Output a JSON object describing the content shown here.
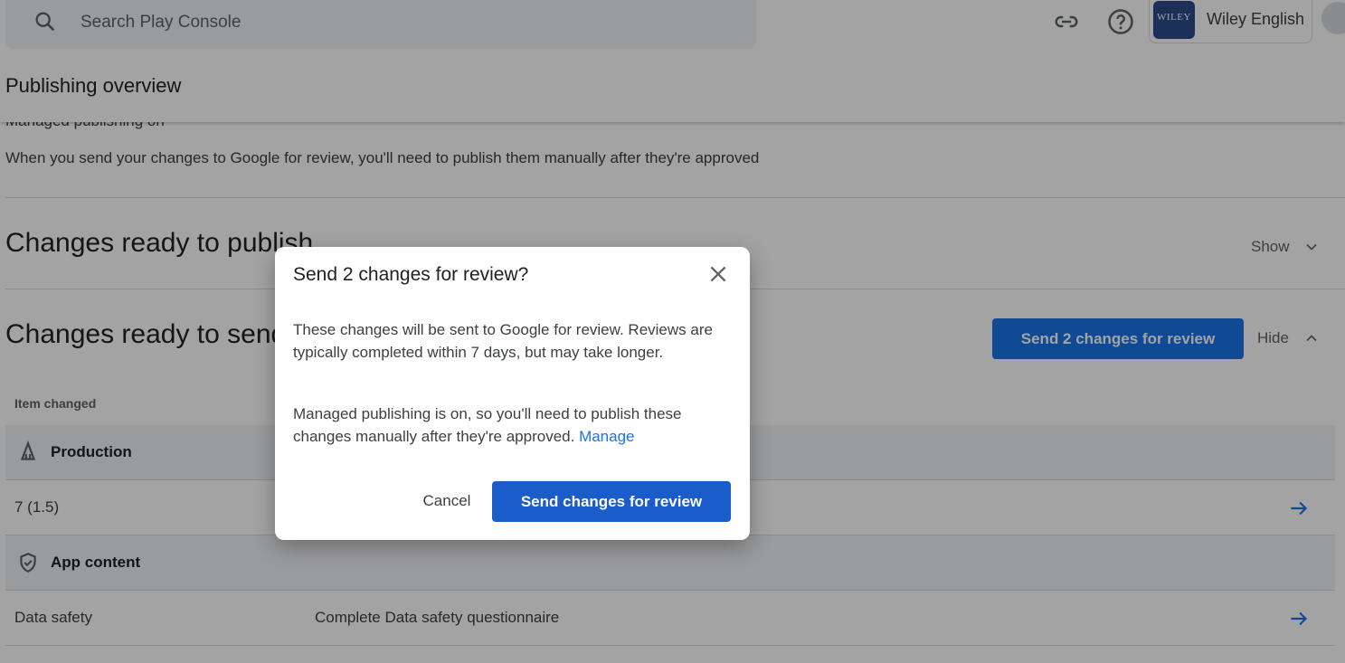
{
  "search": {
    "placeholder": "Search Play Console"
  },
  "account": {
    "logo_text": "WILEY",
    "name": "Wiley English"
  },
  "page": {
    "title": "Publishing overview"
  },
  "managed": {
    "status": "Managed publishing on",
    "description": "When you send your changes to Google for review, you'll need to publish them manually after they're approved"
  },
  "sections": {
    "ready_to_publish": {
      "title": "Changes ready to publish",
      "toggle": "Show"
    },
    "ready_to_send": {
      "title": "Changes ready to send for review",
      "toggle": "Hide",
      "button": "Send 2 changes for review"
    }
  },
  "table": {
    "column_header": "Item changed",
    "groups": [
      {
        "label": "Production",
        "icon": "production-icon",
        "rows": [
          {
            "label": "7 (1.5)",
            "detail": ""
          }
        ]
      },
      {
        "label": "App content",
        "icon": "shield-icon",
        "rows": [
          {
            "label": "Data safety",
            "detail": "Complete Data safety questionnaire"
          }
        ]
      }
    ]
  },
  "dialog": {
    "title": "Send 2 changes for review?",
    "paragraph1": "These changes will be sent to Google for review. Reviews are typically completed within 7 days, but may take longer.",
    "paragraph2": "Managed publishing is on, so you'll need to publish these changes manually after they're approved.",
    "manage_link": "Manage",
    "cancel": "Cancel",
    "confirm": "Send changes for review"
  },
  "colors": {
    "accent": "#1a73e8",
    "button": "#1a5cc9",
    "scrim": "rgba(0,0,0,0.36)"
  }
}
